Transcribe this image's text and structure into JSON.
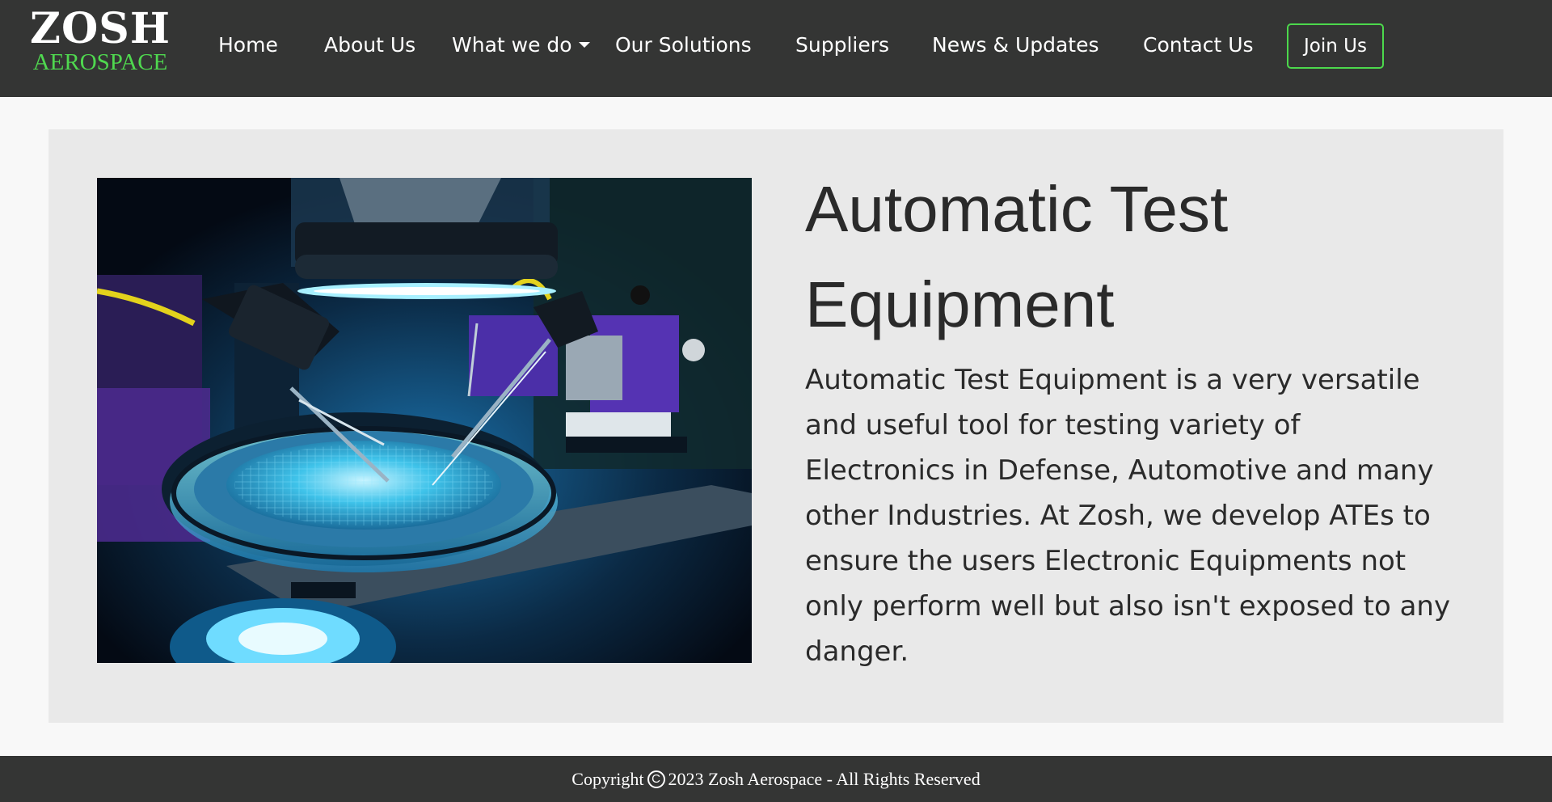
{
  "brand": {
    "name_top": "ZOSH",
    "name_bottom": "AEROSPACE",
    "accent_color": "#4fd84f"
  },
  "nav": {
    "items": [
      {
        "label": "Home"
      },
      {
        "label": "About Us"
      },
      {
        "label": "What we do",
        "has_dropdown": true
      },
      {
        "label": "Our Solutions"
      },
      {
        "label": "Suppliers"
      },
      {
        "label": "News & Updates"
      },
      {
        "label": "Contact Us"
      }
    ],
    "join_label": "Join Us"
  },
  "hero": {
    "image": "wafer-probe-test-station",
    "title": "Automatic Test Equipment",
    "description": "Automatic Test Equipment is a very versatile and useful tool for testing variety of Electronics in Defense, Automotive and many other Industries. At Zosh, we develop ATEs to ensure the users Electronic Equipments not only perform well but also isn't exposed to any danger."
  },
  "footer": {
    "prefix": "Copyright",
    "symbol": "C",
    "text": "2023 Zosh Aerospace - All Rights Reserved"
  },
  "colors": {
    "navbar_bg": "#343534",
    "page_bg": "#f8f8f8",
    "panel_bg": "#e9e9e9",
    "text_dark": "#2a2a2a"
  }
}
